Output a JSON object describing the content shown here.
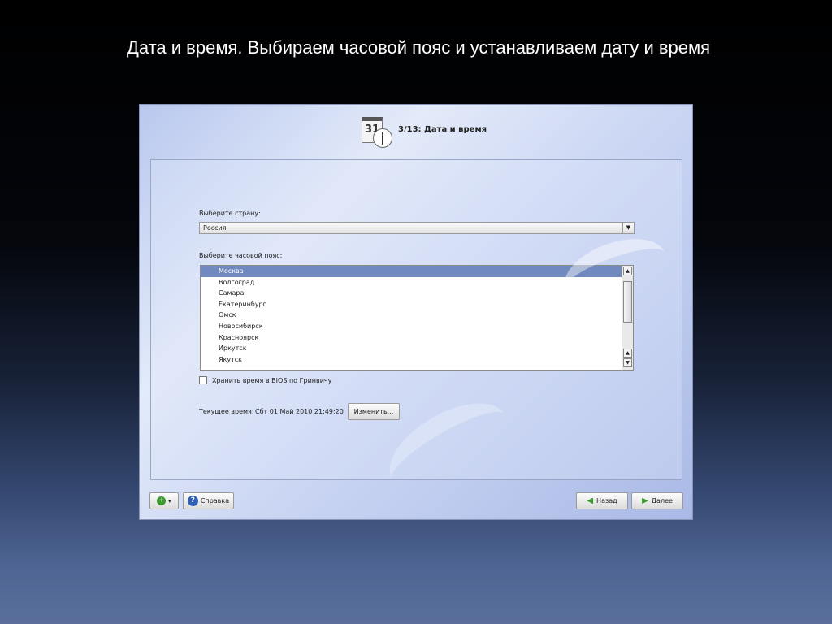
{
  "slide": {
    "title": "Дата и время. Выбираем часовой пояс и устанавливаем дату и время"
  },
  "installer": {
    "calendar_icon_text": "31",
    "step_title": "3/13: Дата и время",
    "country_label": "Выберите страну:",
    "country_value": "Россия",
    "timezone_label": "Выберите часовой пояс:",
    "timezones": [
      "Москва",
      "Волгоград",
      "Самара",
      "Екатеринбург",
      "Омск",
      "Новосибирск",
      "Красноярск",
      "Иркутск",
      "Якутск"
    ],
    "selected_timezone": "Москва",
    "bios_checkbox_label": "Хранить время в BIOS по Гринвичу",
    "bios_checked": false,
    "current_time_label": "Текущее время:",
    "current_time_value": "Сбт 01 Май 2010 21:49:20",
    "change_button": "Изменить...",
    "help_button": "Справка",
    "back_button": "Назад",
    "next_button": "Далее",
    "icons": {
      "calendar": "calendar-clock-icon",
      "add": "green-plus-icon",
      "help": "help-question-icon",
      "back": "arrow-left-icon",
      "next": "arrow-right-icon"
    }
  }
}
